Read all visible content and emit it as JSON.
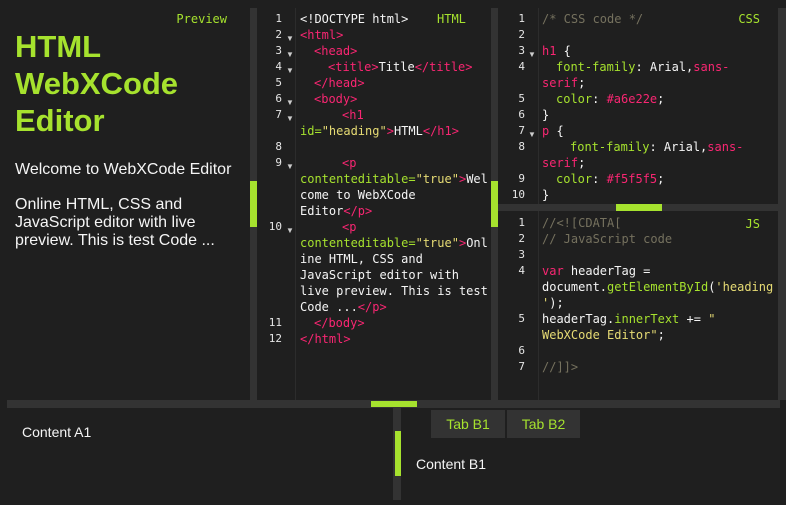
{
  "preview": {
    "label": "Preview",
    "heading": "HTML WebXCode Editor",
    "p1": "Welcome to WebXCode Editor",
    "p2": "Online HTML, CSS and JavaScript editor with live preview. This is test Code ..."
  },
  "html_editor": {
    "label": "HTML",
    "line_numbers": [
      "1",
      "2",
      "3",
      "4",
      "5",
      "6",
      "7",
      "8",
      "9",
      "10",
      "11",
      "12"
    ],
    "code": {
      "l1": "<!DOCTYPE html>",
      "l2": "<html>",
      "l3": "<head>",
      "l4a": "<title>",
      "l4b": "Title",
      "l4c": "</title>",
      "l5": "</head>",
      "l6": "<body>",
      "l7a": "<h1",
      "l7b": "id=",
      "l7c": "\"heading\"",
      "l7d": ">",
      "l7e": "HTML",
      "l7f": "</h1>",
      "l9a": "<p",
      "l9b": "contenteditable=",
      "l9c": "\"true\"",
      "l9d": ">",
      "l9e": "Wel",
      "l9f": "come to WebXCode",
      "l9g": "Editor",
      "l9h": "</p>",
      "l10a": "<p",
      "l10b": "contenteditable=",
      "l10c": "\"true\"",
      "l10d": ">",
      "l10e": "Onl",
      "l10f": "ine HTML, CSS and",
      "l10g": "JavaScript editor with",
      "l10h": "live preview. This is test",
      "l10i": "Code ...",
      "l10j": "</p>",
      "l11": "</body>",
      "l12": "</html>"
    }
  },
  "css_editor": {
    "label": "CSS",
    "line_numbers": [
      "1",
      "2",
      "3",
      "4",
      "5",
      "6",
      "7",
      "8",
      "9",
      "10"
    ],
    "code": {
      "l1": "/* CSS code */",
      "l3a": "h1",
      "l3b": " {",
      "l4a": "font-family",
      "l4b": ": Arial,",
      "l4c": "sans-",
      "l4d": "serif",
      "l4e": ";",
      "l5a": "color",
      "l5b": ": ",
      "l5c": "#a6e22e",
      "l5d": ";",
      "l6": "}",
      "l7a": "p",
      "l7b": " {",
      "l8a": "font-family",
      "l8b": ": Arial,",
      "l8c": "sans-",
      "l8d": "serif",
      "l8e": ";",
      "l9a": "color",
      "l9b": ": ",
      "l9c": "#f5f5f5",
      "l9d": ";",
      "l10": "}"
    }
  },
  "js_editor": {
    "label": "JS",
    "line_numbers": [
      "1",
      "2",
      "3",
      "4",
      "5",
      "6",
      "7"
    ],
    "code": {
      "l1": "//<![CDATA[",
      "l2": "// JavaScript code",
      "l4a": "var",
      "l4b": " headerTag =",
      "l4c": "document.",
      "l4d": "getElementById",
      "l4e": "(",
      "l4f": "'heading",
      "l4g": "'",
      "l4h": ");",
      "l5a": "headerTag.",
      "l5b": "innerText",
      "l5c": " += ",
      "l5d": "\"",
      "l5e": "WebXCode Editor\"",
      "l5f": ";",
      "l7": "//]]>"
    }
  },
  "bottom": {
    "content_a1": "Content A1",
    "tabs": [
      {
        "label": "Tab B1"
      },
      {
        "label": "Tab B2"
      }
    ],
    "content_b1": "Content B1"
  },
  "colors": {
    "accent": "#a6e22e",
    "tag": "#f92672",
    "string": "#e6db74",
    "comment": "#75715e",
    "background": "#1f1f1f"
  }
}
